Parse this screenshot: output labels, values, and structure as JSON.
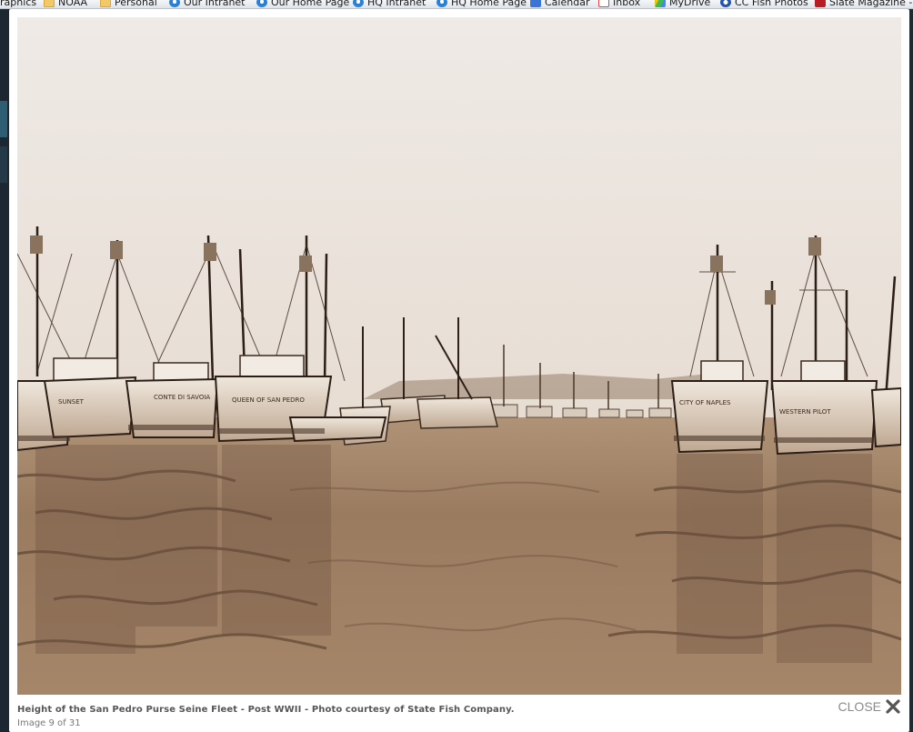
{
  "bookmarks": [
    {
      "label": "raphics",
      "icon": "none"
    },
    {
      "label": "NOAA",
      "icon": "folder-icon"
    },
    {
      "label": "Personal",
      "icon": "folder-icon"
    },
    {
      "label": "Our Intranet",
      "icon": "ie-icon"
    },
    {
      "label": "Our Home Page",
      "icon": "ie-icon"
    },
    {
      "label": "HQ Intranet",
      "icon": "ie-icon"
    },
    {
      "label": "HQ Home Page",
      "icon": "ie-icon"
    },
    {
      "label": "Calendar",
      "icon": "calendar-icon"
    },
    {
      "label": "Inbox",
      "icon": "mail-icon"
    },
    {
      "label": "MyDrive",
      "icon": "drive-icon"
    },
    {
      "label": "CC Fish Photos",
      "icon": "fish-icon"
    },
    {
      "label": "Slate Magazine - F",
      "icon": "slate-icon"
    }
  ],
  "lightbox": {
    "caption": "Height of the San Pedro Purse Seine Fleet - Post WWII - Photo courtesy of State Fish Company.",
    "counter": "Image 9 of 31",
    "close_label": "CLOSE",
    "photo_alt": "Sepia photo of purse seine fishing boats moored in a harbor"
  },
  "colors": {
    "sepia_dark": "#3b2a1e",
    "sepia_mid": "#8c6f57",
    "sepia_light": "#e9e1d8",
    "accent_text": "#555555"
  }
}
